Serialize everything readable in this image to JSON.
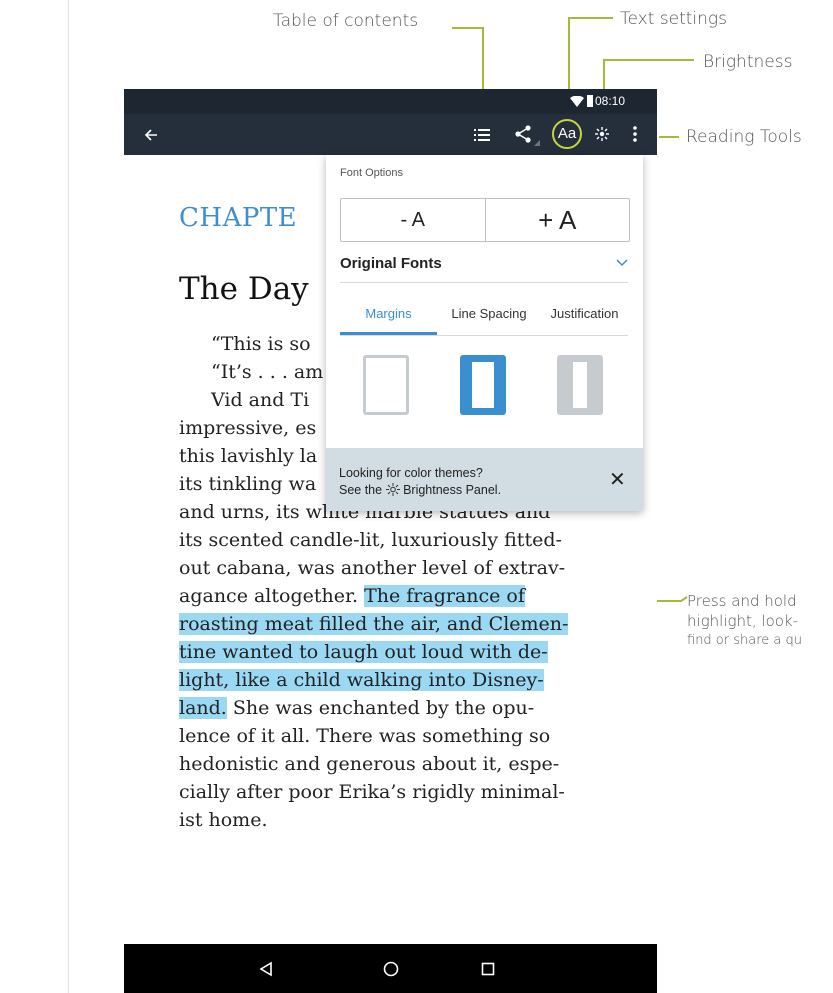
{
  "callouts": {
    "table_of_contents": "Table of contents",
    "text_settings": "Text settings",
    "brightness": "Brightness",
    "reading_tools": "Reading Tools",
    "press_hold_line1": "Press and hold",
    "press_hold_line2": "highlight, look-",
    "press_hold_line3": "find or share a qu"
  },
  "status": {
    "time": "08:10"
  },
  "appbar": {
    "icons": [
      "back-arrow-icon",
      "table-of-contents-icon",
      "share-icon",
      "text-settings-icon",
      "brightness-icon",
      "more-vert-icon"
    ],
    "text_settings_label": "Aa"
  },
  "book": {
    "chapter": "CHAPTE",
    "title": "The Day",
    "lines": [
      "“This is so",
      "“It’s . . . am",
      "Vid and Ti",
      "impressive, es",
      "this lavishly la",
      "its tinkling wa",
      "and urns, its white marble statues and",
      "its scented candle-lit, luxuriously fitted-",
      "out cabana, was another level of extrav-",
      "agance altogether.",
      "The fragrance of",
      "roasting meat filled the air, and Clemen-",
      "tine wanted to laugh out loud with de-",
      "light, like a child walking into Disney-",
      "land.",
      "She was enchanted by the opu-",
      "lence of it all. There was something so",
      "hedonistic and generous about it, espe-",
      "cially after poor Erika’s rigidly minimal-",
      "ist home."
    ]
  },
  "popup": {
    "font_options_label": "Font Options",
    "decrease_label": "- A",
    "increase_label": "+ A",
    "font_select_value": "Original Fonts",
    "tabs": [
      "Margins",
      "Line Spacing",
      "Justification"
    ],
    "active_tab": "Margins",
    "banner_line1": "Looking for color themes?",
    "banner_line2_prefix": "See the",
    "banner_line2_suffix": "Brightness Panel.",
    "close_glyph": "✕"
  },
  "navbar": {
    "icons": [
      "back-triangle-icon",
      "home-circle-icon",
      "recents-square-icon"
    ]
  },
  "colors": {
    "accent": "#3a8fcf",
    "highlight": "#9ad8f3",
    "callout_line": "#a6b93a",
    "appbar": "#252e3b"
  }
}
